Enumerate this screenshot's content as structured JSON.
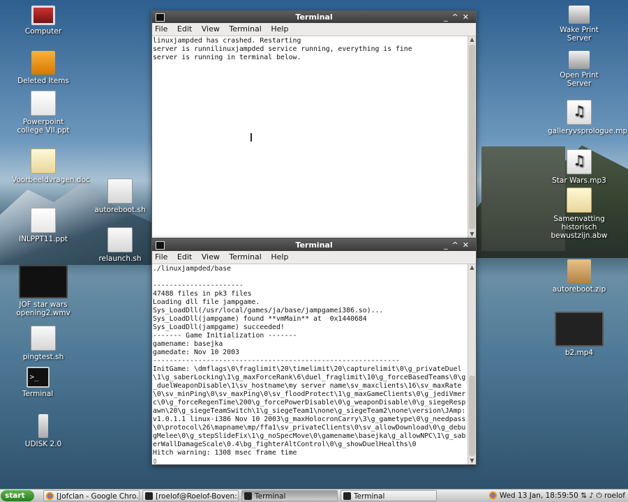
{
  "desktop_left": [
    {
      "label": "Computer",
      "icon": "computer-icon",
      "cls": "ic-monitor"
    },
    {
      "label": "Deleted Items",
      "icon": "trash-icon",
      "cls": "ic-trash"
    },
    {
      "label": "Powerpoint college VII.ppt",
      "icon": "ppt-file-icon",
      "cls": "ic-ppt"
    },
    {
      "label": "Voorbeeldvragen.doc",
      "icon": "doc-file-icon",
      "cls": "ic-doc"
    },
    {
      "label": "INLPPT11.ppt",
      "icon": "ppt-file-icon",
      "cls": "ic-ppt"
    },
    {
      "label": "JOF star wars opening2.wmv",
      "icon": "video-file-icon",
      "cls": "ic-video"
    },
    {
      "label": "pingtest.sh",
      "icon": "script-file-icon",
      "cls": "ic-sh"
    },
    {
      "label": "Terminal",
      "icon": "terminal-icon",
      "cls": "ic-term"
    },
    {
      "label": "UDISK 2.0",
      "icon": "usb-drive-icon",
      "cls": "ic-usb"
    }
  ],
  "desktop_mid": [
    {
      "label": "autoreboot.sh",
      "icon": "script-file-icon",
      "cls": "ic-sh"
    },
    {
      "label": "relaunch.sh",
      "icon": "script-file-icon",
      "cls": "ic-sh"
    }
  ],
  "desktop_right": [
    {
      "label": "Wake Print Server",
      "icon": "printer-icon",
      "cls": "ic-printer"
    },
    {
      "label": "Open Print Server",
      "icon": "printer-network-icon",
      "cls": "ic-printer"
    },
    {
      "label": "galleryvsprologue.mp3",
      "icon": "audio-file-icon",
      "cls": "ic-mp3"
    },
    {
      "label": "Star Wars.mp3",
      "icon": "audio-file-icon",
      "cls": "ic-mp3"
    },
    {
      "label": "Samenvatting historisch bewustzijn.abw",
      "icon": "doc-file-icon",
      "cls": "ic-doc"
    },
    {
      "label": "autoreboot.zip",
      "icon": "archive-icon",
      "cls": "ic-zip"
    },
    {
      "label": "b2.mp4",
      "icon": "video-file-icon",
      "cls": "ic-b2"
    }
  ],
  "menu": [
    "File",
    "Edit",
    "View",
    "Terminal",
    "Help"
  ],
  "terminal1": {
    "title": "Terminal",
    "text": "linuxjampded has crashed. Restarting\nserver is runnilinuxjampded service running, everything is fine\nserver is running in terminal below."
  },
  "terminal2": {
    "title": "Terminal",
    "text": "./linuxjampded/base\n\n----------------------\n47488 files in pk3 files\nLoading dll file jampgame.\nSys_LoadDll(/usr/local/games/ja/base/jampgamei386.so)...\nSys_LoadDll(jampgame) found **vmMain** at  0x1440684\nSys_LoadDll(jampgame) succeeded!\n------- Game Initialization -------\ngamename: basejka\ngamedate: Nov 10 2003\n------------------------------------------------------------\nInitGame: \\dmflags\\0\\fraglimit\\20\\timelimit\\20\\capturelimit\\0\\g_privateDuel\\1\\g_saberLocking\\1\\g_maxForceRank\\6\\duel_fraglimit\\10\\g_forceBasedTeams\\0\\g_duelWeaponDisable\\1\\sv_hostname\\my server name\\sv_maxclients\\16\\sv_maxRate\\0\\sv_minPing\\0\\sv_maxPing\\0\\sv_floodProtect\\1\\g_maxGameClients\\0\\g_jediVmerc\\0\\g_forceRegenTime\\200\\g_forcePowerDisable\\0\\g_weaponDisable\\0\\g_siegeRespawn\\20\\g_siegeTeamSwitch\\1\\g_siegeTeam1\\none\\g_siegeTeam2\\none\\version\\JAmp: v1.0.1.1 linux-i386 Nov 10 2003\\g_maxHolocronCarry\\3\\g_gametype\\0\\g_needpass\\0\\protocol\\26\\mapname\\mp/ffa1\\sv_privateClients\\0\\sv_allowDownload\\0\\g_debugMelee\\0\\g_stepSlideFix\\1\\g_noSpecMove\\0\\gamename\\basejka\\g_allowNPC\\1\\g_saberWallDamageScale\\0.4\\bg_fighterAltControl\\0\\g_showDuelHealths\\0\nHitch warning: 1308 msec frame time\n▯"
  },
  "taskbar": {
    "start": "start",
    "buttons": [
      "[Jofclan - Google Chro...",
      "[roelof@Roelof-Boven:...",
      "Terminal",
      "Terminal"
    ],
    "clock": "Wed 13 Jan, 18:59:50",
    "user": "roelof"
  }
}
